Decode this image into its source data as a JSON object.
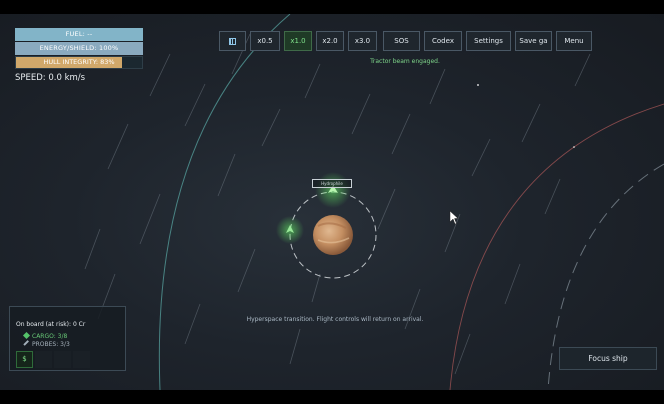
{
  "status": {
    "fuel_label": "FUEL: --",
    "energy_label": "ENERGY/SHIELD: 100%",
    "hull_label": "HULL INTEGRITY: 83%",
    "hull_fraction": 0.84,
    "speed_label": "SPEED: 0.0 km/s"
  },
  "toolbar": {
    "pause_icon": "pause-icon",
    "speed_buttons": [
      "x0.5",
      "x1.0",
      "x2.0",
      "x3.0"
    ],
    "active_speed": "x1.0",
    "sos_label": "SOS",
    "codex_label": "Codex",
    "settings_label": "Settings",
    "save_label": "Save ga",
    "menu_label": "Menu"
  },
  "messages": {
    "top": "Tractor beam engaged.",
    "bottom": "Hyperspace transition. Flight controls will return on arrival."
  },
  "planet": {
    "label": "Hydrophile"
  },
  "cargo_panel": {
    "onboard": "On board (at risk): 0 Cr",
    "cargo": "CARGO: 3/8",
    "probes": "PROBES: 3/3",
    "slot_1": "$"
  },
  "focus_button": "Focus ship",
  "colors": {
    "accent_green": "#7fe08a",
    "hull": "#d1a86a",
    "fuel": "#82b4c8"
  }
}
